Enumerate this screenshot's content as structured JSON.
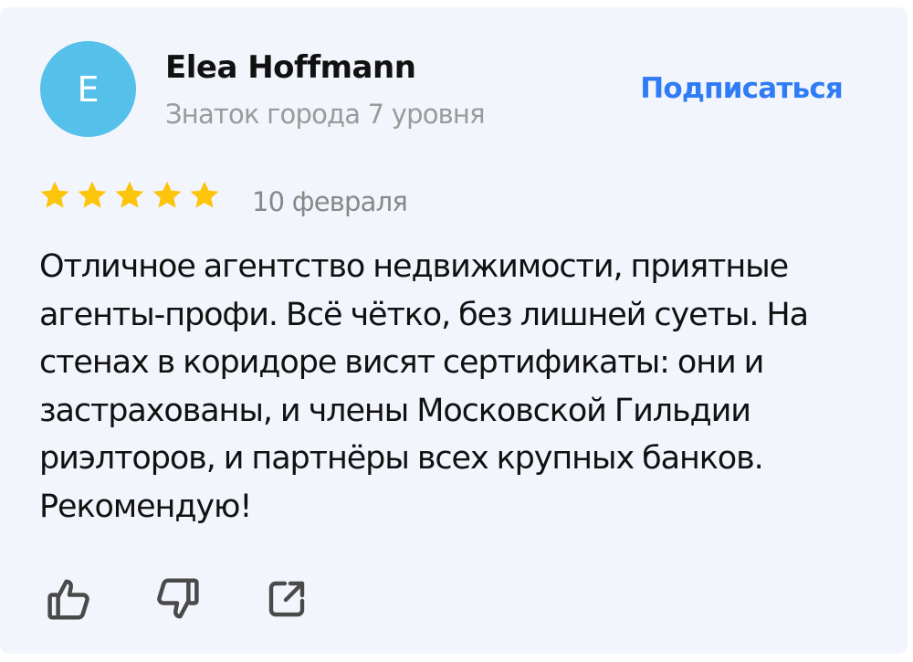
{
  "author": {
    "initial": "E",
    "name": "Elea Hoffmann",
    "level": "Знаток города 7 уровня",
    "avatar_color": "#55c0ea"
  },
  "subscribe_label": "Подписаться",
  "review": {
    "rating": 5,
    "max_rating": 5,
    "date": "10 февраля",
    "text": "Отличное агентство недвижимости, приятные агенты-профи. Всё чётко, без лишней суеты. На стенах в коридоре висят сертификаты: они и застрахованы, и члены Московской Гильдии риэлторов, и партнёры всех крупных банков. Рекомендую!"
  },
  "actions": [
    {
      "name": "like",
      "icon": "thumbs-up-icon"
    },
    {
      "name": "dislike",
      "icon": "thumbs-down-icon"
    },
    {
      "name": "share",
      "icon": "share-icon"
    }
  ],
  "colors": {
    "accent": "#2f7cf6",
    "star": "#fcc40a",
    "card_bg": "#f2f5fc"
  }
}
